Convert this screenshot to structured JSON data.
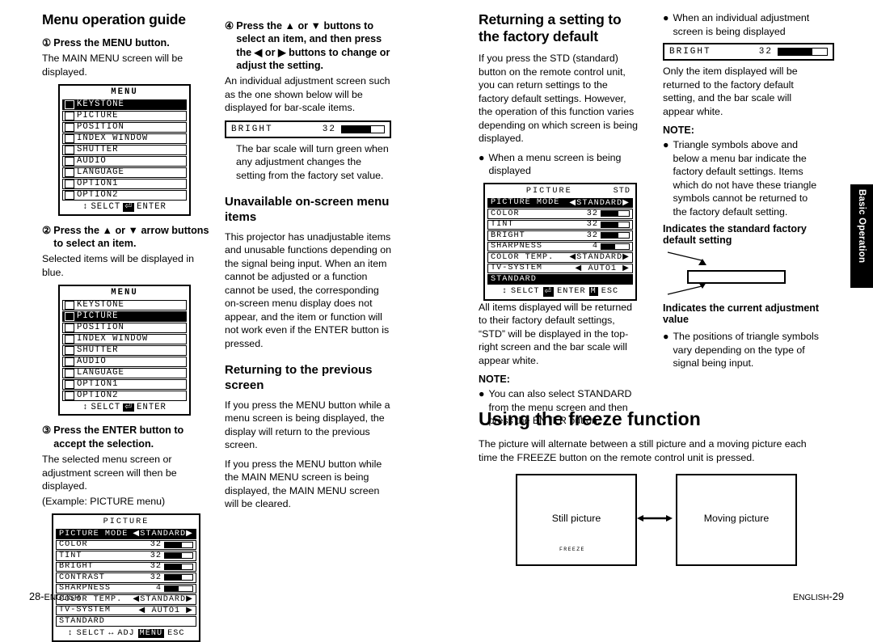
{
  "columns": {
    "c1": {
      "heading": "Menu operation guide",
      "step1": {
        "num": "①",
        "text": "Press the MENU button."
      },
      "step1_body": "The MAIN MENU screen will be displayed.",
      "menu1": {
        "title": "MENU",
        "rows": [
          {
            "label": "KEYSTONE",
            "selected": true
          },
          {
            "label": "PICTURE",
            "selected": false
          },
          {
            "label": "POSITION",
            "selected": false
          },
          {
            "label": "INDEX WINDOW",
            "selected": false
          },
          {
            "label": "SHUTTER",
            "selected": false
          },
          {
            "label": "AUDIO",
            "selected": false
          },
          {
            "label": "LANGUAGE",
            "selected": false
          },
          {
            "label": "OPTION1",
            "selected": false
          },
          {
            "label": "OPTION2",
            "selected": false
          }
        ],
        "footer_left": "SELCT",
        "footer_mid": "⏎",
        "footer_right": "ENTER"
      },
      "step2": {
        "num": "②",
        "text": "Press the ▲ or ▼ arrow buttons to select an item."
      },
      "step2_body": "Selected items will be displayed in blue.",
      "menu2": {
        "title": "MENU",
        "rows": [
          {
            "label": "KEYSTONE",
            "selected": false
          },
          {
            "label": "PICTURE",
            "selected": true
          },
          {
            "label": "POSITION",
            "selected": false
          },
          {
            "label": "INDEX WINDOW",
            "selected": false
          },
          {
            "label": "SHUTTER",
            "selected": false
          },
          {
            "label": "AUDIO",
            "selected": false
          },
          {
            "label": "LANGUAGE",
            "selected": false
          },
          {
            "label": "OPTION1",
            "selected": false
          },
          {
            "label": "OPTION2",
            "selected": false
          }
        ],
        "footer_left": "SELCT",
        "footer_mid": "⏎",
        "footer_right": "ENTER"
      },
      "step3": {
        "num": "③",
        "text": "Press the ENTER button to accept the selection."
      },
      "step3_body": "The selected menu screen or adjustment screen will then be displayed.",
      "step3_example": "(Example: PICTURE menu)",
      "picture_menu": {
        "title": "PICTURE",
        "rows": [
          {
            "label": "PICTURE MODE",
            "value": "◀STANDARD▶",
            "dark": true,
            "bar": null
          },
          {
            "label": "COLOR",
            "value": "32",
            "bar": 62
          },
          {
            "label": "TINT",
            "value": "32",
            "bar": 62
          },
          {
            "label": "BRIGHT",
            "value": "32",
            "bar": 62
          },
          {
            "label": "CONTRAST",
            "value": "32",
            "bar": 62
          },
          {
            "label": "SHARPNESS",
            "value": "4",
            "bar": 50
          },
          {
            "label": "COLOR TEMP.",
            "value": "◀STANDARD▶",
            "bar": null
          },
          {
            "label": "TV-SYSTEM",
            "value": "◀ AUTO1 ▶",
            "bar": null
          },
          {
            "label": "STANDARD",
            "value": "",
            "bar": null
          }
        ],
        "footer_left": "SELCT",
        "footer_mid": "ADJ",
        "footer_right": "ESC",
        "footer_icon": "MENU"
      }
    },
    "c2": {
      "step4": {
        "num": "④",
        "text": "Press the ▲ or ▼ buttons to select an item, and then press the ◀ or ▶ buttons to change or adjust the setting."
      },
      "step4_body": "An individual adjustment screen such as the one shown below will be displayed for bar-scale items.",
      "barbox": {
        "label": "BRIGHT",
        "value": "32"
      },
      "step4_note": "The bar scale will turn green when any adjustment changes the setting from the factory set value.",
      "heading2": "Unavailable on-screen menu items",
      "para1": "This projector has unadjustable items and unusable functions depending on the signal being input. When an item cannot be adjusted or a function cannot be used, the corresponding on-screen menu display does not appear, and the item or function will not work even if the ENTER button is pressed.",
      "heading3": "Returning to the previous screen",
      "para2": "If you press the MENU button while a menu screen is being displayed, the display will return to the previous screen.",
      "para3": "If you press the MENU button while the MAIN MENU screen is being displayed, the MAIN MENU screen will be cleared."
    },
    "c3": {
      "heading": "Returning a setting to the factory default",
      "para1": "If you press the STD (standard) button on the remote control unit, you can return settings to the factory default settings. However, the operation of this function varies depending on which screen is being displayed.",
      "bullet1": "When a menu screen is being displayed",
      "picture_menu": {
        "title": "PICTURE",
        "title_right": "STD",
        "rows": [
          {
            "label": "PICTURE MODE",
            "value": "◀STANDARD▶",
            "dark": true,
            "bar": null
          },
          {
            "label": "COLOR",
            "value": "32",
            "bar": 62
          },
          {
            "label": "TINT",
            "value": "32",
            "bar": 62
          },
          {
            "label": "BRIGHT",
            "value": "32",
            "bar": 62
          },
          {
            "label": "SHARPNESS",
            "value": "4",
            "bar": 50
          },
          {
            "label": "COLOR TEMP.",
            "value": "◀STANDARD▶",
            "bar": null
          },
          {
            "label": "TV-SYSTEM",
            "value": "◀ AUTO1 ▶",
            "bar": null
          },
          {
            "label": "STANDARD",
            "value": "",
            "dark": true,
            "bar": null
          }
        ],
        "footer_left": "SELCT",
        "footer_mid": "ENTER",
        "footer_right": "ESC"
      },
      "para2": "All items displayed will be returned to their factory default settings, “STD” will be displayed in the top-right screen and the bar scale will appear white.",
      "note_label": "NOTE:",
      "note_bullet": "You can also select STANDARD from the menu screen and then press the ENTER button.",
      "heading2": "Using the freeze function",
      "para3": "The picture will alternate between a still picture and a moving picture each time the FREEZE button on the remote control unit is pressed.",
      "freeze": {
        "left_label": "Still picture",
        "right_label": "Moving picture",
        "freeze_text": "FREEZE"
      }
    },
    "c4": {
      "bullet1": "When an individual adjustment screen is being displayed",
      "barbox": {
        "label": "BRIGHT",
        "value": "32"
      },
      "para1": "Only the item displayed will be returned to the factory default setting, and the bar scale will appear white.",
      "note_label": "NOTE:",
      "note_bullet": "Triangle symbols above and below a menu bar indicate the factory default settings. Items which do not have these triangle symbols cannot be returned to the factory default setting.",
      "caption1": "Indicates the standard factory default setting",
      "caption2": "Indicates the current adjustment value",
      "bullet2": "The positions of triangle symbols vary depending on the type of signal being input."
    }
  },
  "side_tab": "Basic Operation",
  "footer": {
    "left": "28-ENGLISH",
    "right": "ENGLISH-29"
  }
}
